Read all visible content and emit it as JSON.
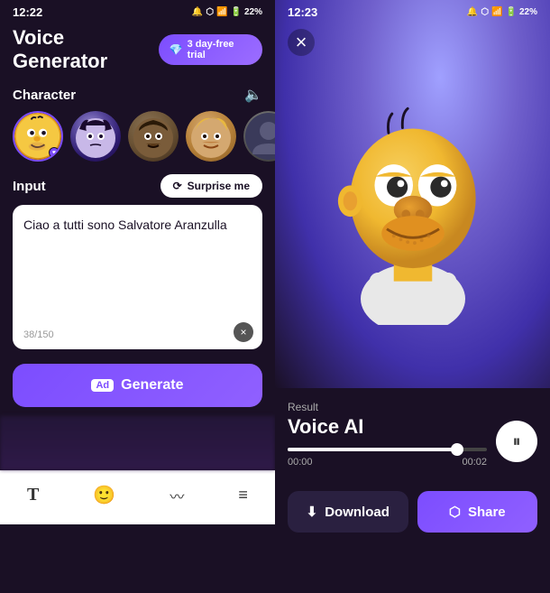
{
  "leftPanel": {
    "statusBar": {
      "time": "12:22",
      "batteryLevel": "22%",
      "icons": "🔔 ✈ 📶 🔋"
    },
    "header": {
      "title": "Voice Generator",
      "trialBadge": "3 day-free trial",
      "trialIcon": "💎"
    },
    "characterSection": {
      "label": "Character",
      "characters": [
        {
          "id": "homer",
          "emoji": "🟡",
          "selected": true
        },
        {
          "id": "wednesday",
          "emoji": "👧",
          "selected": false
        },
        {
          "id": "obama",
          "emoji": "👨",
          "selected": false
        },
        {
          "id": "trump",
          "emoji": "👴",
          "selected": false
        },
        {
          "id": "extra",
          "emoji": "👤",
          "selected": false
        }
      ]
    },
    "inputSection": {
      "label": "Input",
      "surpriseBtn": "Surprise me",
      "surpriseIcon": "⟳",
      "textContent": "Ciao a tutti sono Salvatore Aranzulla",
      "charCount": "38/150",
      "clearBtn": "×"
    },
    "generateBtn": {
      "label": "Generate",
      "icon": "Ad"
    },
    "bottomNav": {
      "items": [
        {
          "id": "text",
          "icon": "T",
          "label": "Text"
        },
        {
          "id": "emoji",
          "icon": "🙂",
          "label": "Emoji"
        },
        {
          "id": "audio",
          "icon": "〰",
          "label": "Audio"
        },
        {
          "id": "menu",
          "icon": "≡",
          "label": "Menu"
        }
      ]
    }
  },
  "rightPanel": {
    "statusBar": {
      "time": "12:23",
      "batteryLevel": "22%"
    },
    "closeBtn": "×",
    "result": {
      "label": "Result",
      "title": "Voice AI"
    },
    "audioPlayer": {
      "playPauseIcon": "⏸",
      "progressPercent": 85,
      "currentTime": "00:00",
      "totalTime": "00:02"
    },
    "downloadBtn": "Download",
    "shareBtn": "Share",
    "downloadIcon": "⬇",
    "shareIcon": "⬡"
  }
}
